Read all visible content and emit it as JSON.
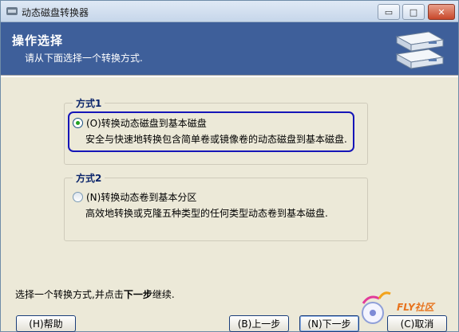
{
  "window": {
    "title": "动态磁盘转换器",
    "controls": {
      "minimize": "▭",
      "maximize": "□",
      "close": "✕"
    }
  },
  "header": {
    "title": "操作选择",
    "subtitle": "请从下面选择一个转换方式.",
    "icon": "disk-drives-icon",
    "background": "#3e5f9a"
  },
  "options": [
    {
      "group_label": "方式1",
      "option_label": "(O)转换动态磁盘到基本磁盘",
      "description": "安全与快速地转换包含简单卷或镜像卷的动态磁盘到基本磁盘.",
      "selected": true
    },
    {
      "group_label": "方式2",
      "option_label": "(N)转换动态卷到基本分区",
      "description": "高效地转换或克隆五种类型的任何类型动态卷到基本磁盘.",
      "selected": false
    }
  ],
  "hint": {
    "prefix": "选择一个转换方式,并点击",
    "bold": "下一步",
    "suffix": "继续."
  },
  "buttons": {
    "help": "(H)帮助",
    "prev": "(B)上一步",
    "next": "(N)下一步",
    "cancel": "(C)取消"
  },
  "watermark": {
    "text": "FLY社区"
  },
  "colors": {
    "focus_ring": "#1515b8",
    "group_label": "#0a246a",
    "radio_checked": "#21a121"
  }
}
